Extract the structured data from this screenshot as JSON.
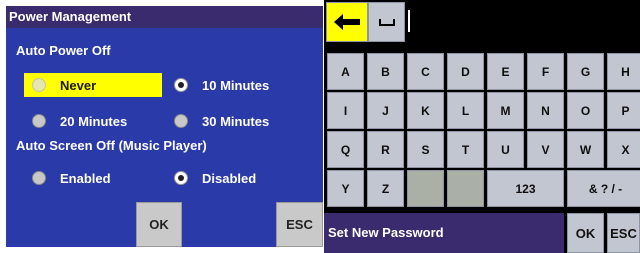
{
  "power_management": {
    "title": "Power Management",
    "auto_power_off": {
      "label": "Auto Power Off",
      "options": [
        {
          "label": "Never",
          "selected": false,
          "highlighted": true
        },
        {
          "label": "10 Minutes",
          "selected": true,
          "highlighted": false
        },
        {
          "label": "20 Minutes",
          "selected": false,
          "highlighted": false
        },
        {
          "label": "30 Minutes",
          "selected": false,
          "highlighted": false
        }
      ]
    },
    "auto_screen_off": {
      "label": "Auto Screen Off (Music Player)",
      "options": [
        {
          "label": "Enabled",
          "selected": false
        },
        {
          "label": "Disabled",
          "selected": true
        }
      ]
    },
    "ok_label": "OK",
    "esc_label": "ESC"
  },
  "keyboard": {
    "backspace_icon": "left-arrow-icon",
    "space_icon": "space-icon",
    "input_value": "",
    "rows": [
      [
        "A",
        "B",
        "C",
        "D",
        "E",
        "F",
        "G",
        "H"
      ],
      [
        "I",
        "J",
        "K",
        "L",
        "M",
        "N",
        "O",
        "P"
      ],
      [
        "Q",
        "R",
        "S",
        "T",
        "U",
        "V",
        "W",
        "X"
      ]
    ],
    "last_row": {
      "y": "Y",
      "z": "Z",
      "numbers": "123",
      "symbols": "& ? / -"
    },
    "status": "Set New Password",
    "ok_label": "OK",
    "esc_label": "ESC"
  },
  "colors": {
    "panel_blue": "#2a3aa8",
    "title_purple": "#3a2a6e",
    "highlight_yellow": "#ffff00",
    "key_gray": "#c2c6d0"
  }
}
